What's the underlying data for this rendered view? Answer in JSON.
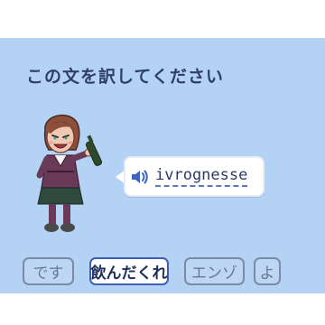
{
  "prompt": {
    "text": "この文を訳してください"
  },
  "bubble": {
    "word": "ivrognesse",
    "speaker_icon": "speaker-icon"
  },
  "choices": [
    {
      "label": "です",
      "selected": false
    },
    {
      "label": "飲んだくれ",
      "selected": true
    },
    {
      "label": "エンゾ",
      "selected": false
    },
    {
      "label": "よ",
      "selected": false
    }
  ],
  "colors": {
    "panel_bg": "#b4d2f3",
    "selected_border": "#3f5fb4",
    "prompt_text": "#2f3f66"
  }
}
